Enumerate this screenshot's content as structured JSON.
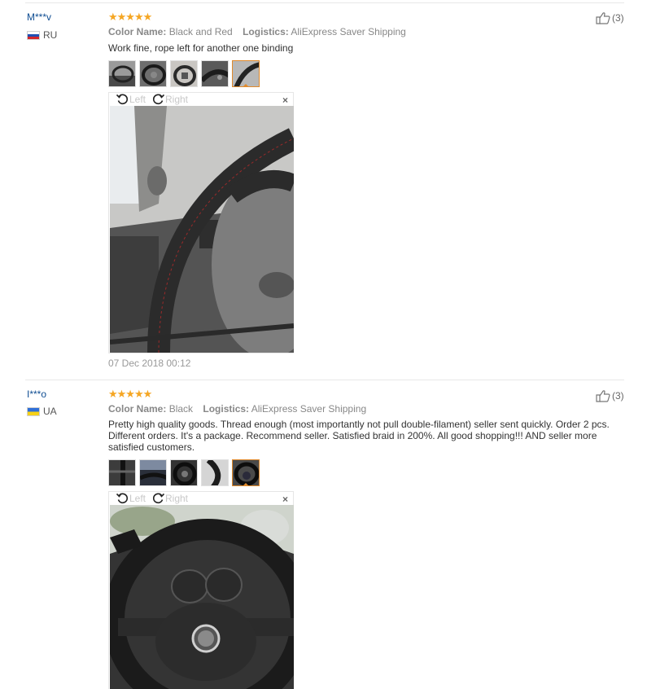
{
  "reviews": [
    {
      "user": "M***v",
      "country": "RU",
      "stars": "★★★★★",
      "color_label": "Color Name:",
      "color_value": "Black and Red",
      "logistics_label": "Logistics:",
      "logistics_value": "AliExpress Saver Shipping",
      "text": "Work fine, rope left for another one binding",
      "helpful_count": "(3)",
      "viewer": {
        "left": "Left",
        "right": "Right",
        "close": "×"
      },
      "date": "07 Dec 2018 00:12"
    },
    {
      "user": "I***o",
      "country": "UA",
      "stars": "★★★★★",
      "color_label": "Color Name:",
      "color_value": "Black",
      "logistics_label": "Logistics:",
      "logistics_value": "AliExpress Saver Shipping",
      "text": "Pretty high quality goods. Thread enough (most importantly not pull double-filament) seller sent quickly. Order 2 pcs. Different orders. It's a package. Recommend seller. Satisfied braid in 200%. All good shopping!!! AND seller more satisfied customers.",
      "helpful_count": "(3)",
      "viewer": {
        "left": "Left",
        "right": "Right",
        "close": "×"
      }
    }
  ],
  "icons": {
    "thumbs_up": "thumbs-up-icon",
    "rotate_left": "rotate-left-icon",
    "rotate_right": "rotate-right-icon",
    "close": "close-icon"
  },
  "colors": {
    "username": "#0f4d92",
    "star": "#f5a623",
    "active_thumb": "#e08a2c",
    "meta_text": "#888888"
  }
}
